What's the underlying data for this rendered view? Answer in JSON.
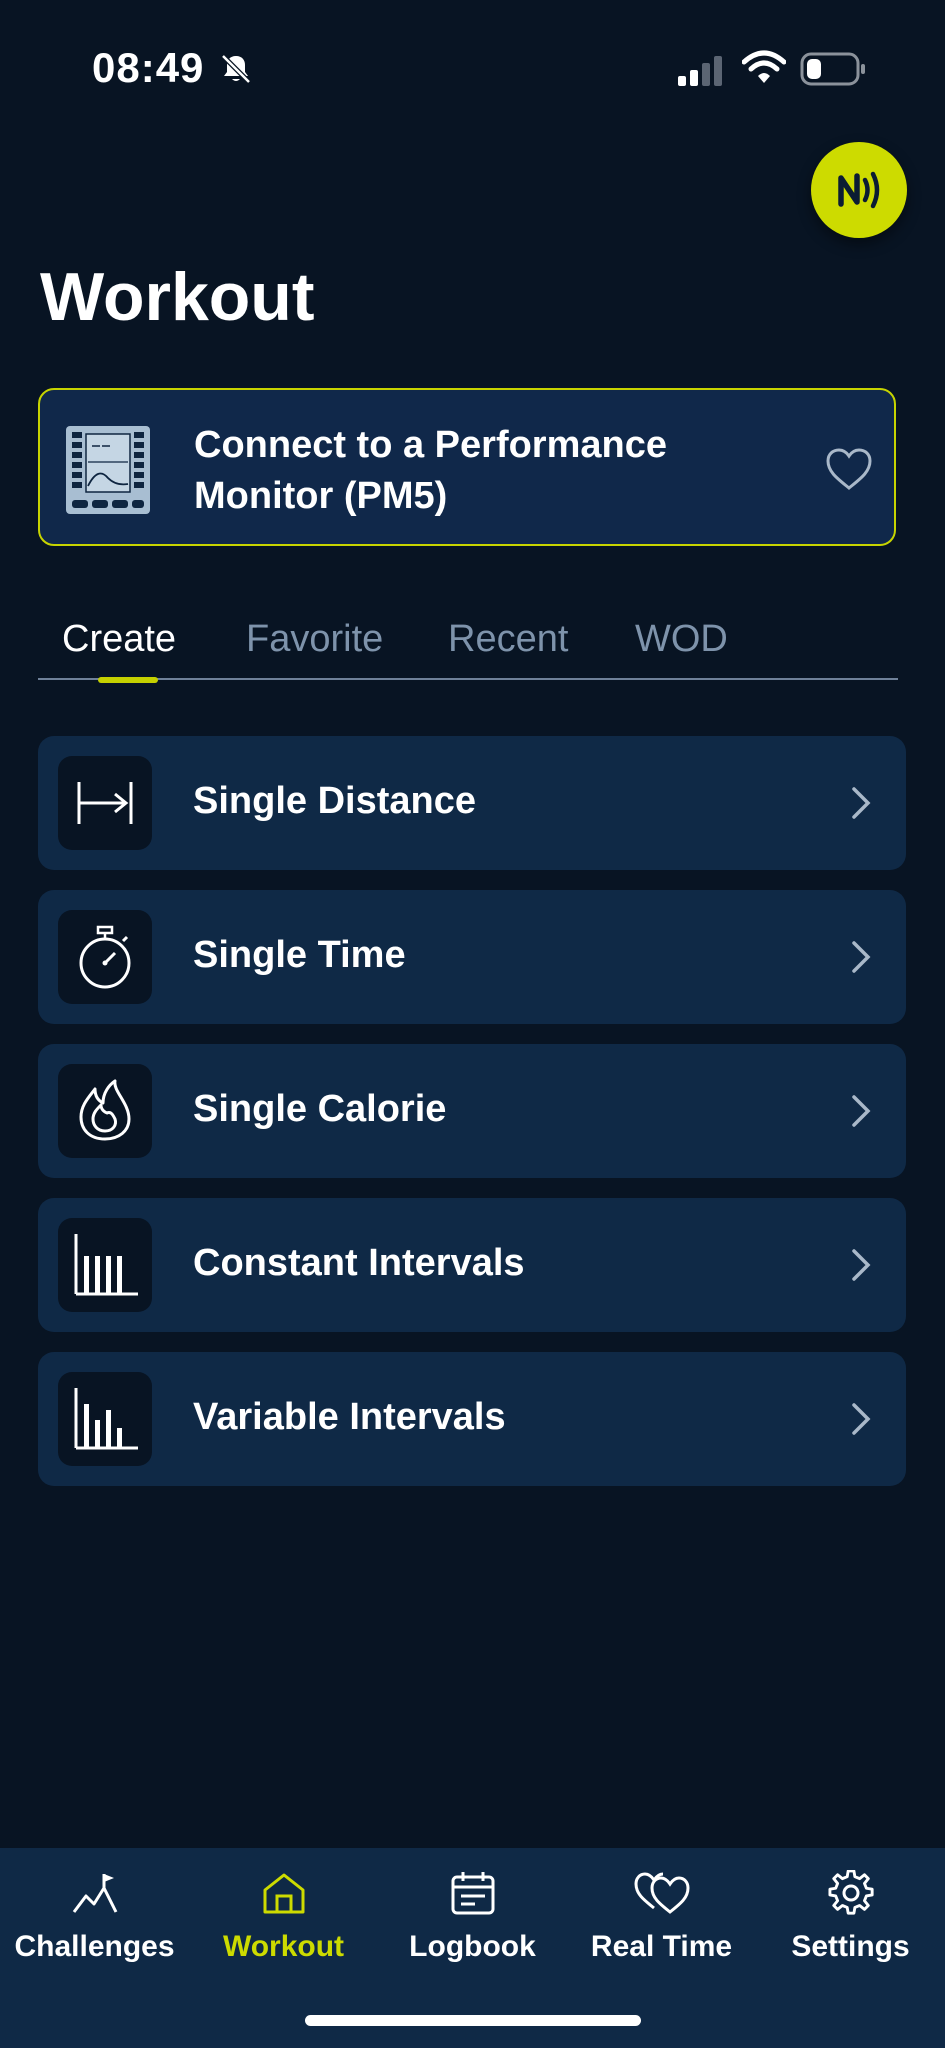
{
  "status_bar": {
    "time": "08:49",
    "bell_icon": "bell-slash-icon",
    "signal_icon": "cellular-signal-icon",
    "wifi_icon": "wifi-icon",
    "battery_icon": "battery-low-icon"
  },
  "nfc_button": {
    "icon": "nfc-icon",
    "accent_color": "#cddb00"
  },
  "page": {
    "title": "Workout"
  },
  "connect_card": {
    "label": "Connect to a Performance Monitor (PM5)",
    "icon": "pm5-monitor-icon",
    "favorite_icon": "heart-outline-icon",
    "border_color": "#c7d400"
  },
  "tabs": [
    {
      "label": "Create",
      "active": true
    },
    {
      "label": "Favorite",
      "active": false
    },
    {
      "label": "Recent",
      "active": false
    },
    {
      "label": "WOD",
      "active": false
    }
  ],
  "workout_types": [
    {
      "label": "Single Distance",
      "icon": "distance-arrow-icon"
    },
    {
      "label": "Single Time",
      "icon": "stopwatch-icon"
    },
    {
      "label": "Single Calorie",
      "icon": "flame-icon"
    },
    {
      "label": "Constant Intervals",
      "icon": "constant-bars-icon"
    },
    {
      "label": "Variable Intervals",
      "icon": "variable-bars-icon"
    }
  ],
  "bottom_nav": [
    {
      "label": "Challenges",
      "icon": "mountain-flag-icon",
      "active": false
    },
    {
      "label": "Workout",
      "icon": "home-icon",
      "active": true
    },
    {
      "label": "Logbook",
      "icon": "calendar-icon",
      "active": false
    },
    {
      "label": "Real Time",
      "icon": "hearts-icon",
      "active": false
    },
    {
      "label": "Settings",
      "icon": "gear-icon",
      "active": false
    }
  ],
  "colors": {
    "background": "#081423",
    "card": "#0f2946",
    "accent": "#cddb00",
    "inactive_tab": "#7e93ab"
  }
}
